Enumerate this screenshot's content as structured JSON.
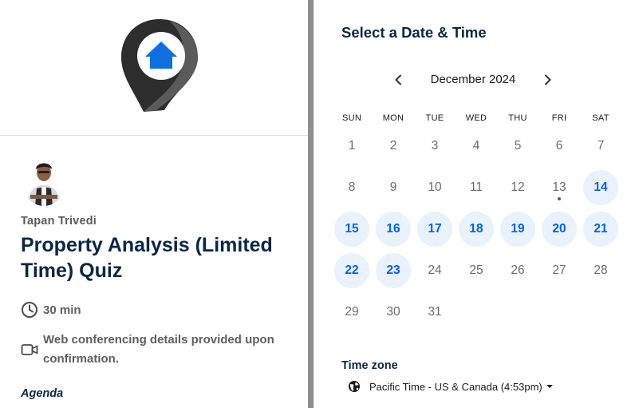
{
  "host": {
    "name": "Tapan Trivedi",
    "avatar_icon": "person-avatar"
  },
  "event": {
    "title": "Property Analysis (Limited Time) Quiz",
    "duration": "30 min",
    "conferencing": "Web conferencing details provided upon confirmation.",
    "agenda_label": "Agenda"
  },
  "icons": {
    "logo": "location-pin-home-icon",
    "duration": "clock-icon",
    "conferencing": "video-camera-icon",
    "prev": "chevron-left-icon",
    "next": "chevron-right-icon",
    "timezone": "globe-icon"
  },
  "calendar": {
    "heading": "Select a Date & Time",
    "month": "December 2024",
    "weekdays": [
      "SUN",
      "MON",
      "TUE",
      "WED",
      "THU",
      "FRI",
      "SAT"
    ],
    "weeks": [
      [
        {
          "day": "1"
        },
        {
          "day": "2"
        },
        {
          "day": "3"
        },
        {
          "day": "4"
        },
        {
          "day": "5"
        },
        {
          "day": "6"
        },
        {
          "day": "7"
        }
      ],
      [
        {
          "day": "8"
        },
        {
          "day": "9"
        },
        {
          "day": "10"
        },
        {
          "day": "11"
        },
        {
          "day": "12"
        },
        {
          "day": "13",
          "today": true
        },
        {
          "day": "14",
          "available": true
        }
      ],
      [
        {
          "day": "15",
          "available": true
        },
        {
          "day": "16",
          "available": true
        },
        {
          "day": "17",
          "available": true
        },
        {
          "day": "18",
          "available": true
        },
        {
          "day": "19",
          "available": true
        },
        {
          "day": "20",
          "available": true
        },
        {
          "day": "21",
          "available": true
        }
      ],
      [
        {
          "day": "22",
          "available": true
        },
        {
          "day": "23",
          "available": true
        },
        {
          "day": "24"
        },
        {
          "day": "25"
        },
        {
          "day": "26"
        },
        {
          "day": "27"
        },
        {
          "day": "28"
        }
      ],
      [
        {
          "day": "29"
        },
        {
          "day": "30"
        },
        {
          "day": "31"
        }
      ]
    ]
  },
  "timezone": {
    "label": "Time zone",
    "value": "Pacific Time - US & Canada (4:53pm)"
  },
  "colors": {
    "brand_dark": "#0b2644",
    "accent_blue": "#0060e6",
    "available_bg": "#e8f1fc"
  }
}
